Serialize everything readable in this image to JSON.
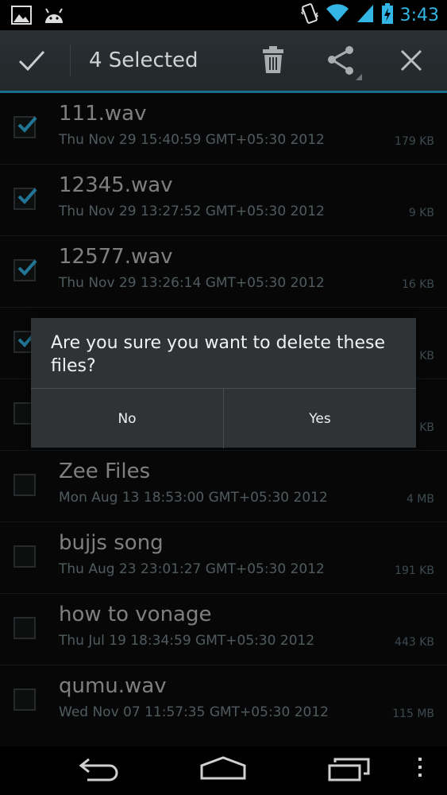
{
  "status_bar": {
    "time": "3:43",
    "icons": [
      "gallery-icon",
      "android-icon",
      "vibrate-icon",
      "wifi-icon",
      "signal-icon",
      "battery-charging-icon"
    ]
  },
  "action_bar": {
    "title": "4 Selected",
    "icons": [
      "checkmark-icon",
      "trash-icon",
      "share-icon",
      "close-icon"
    ],
    "accent_color": "#33b5e5"
  },
  "files": [
    {
      "name": "111.wav",
      "date": "Thu Nov 29 15:40:59 GMT+05:30 2012",
      "size": "179 KB",
      "checked": true
    },
    {
      "name": "12345.wav",
      "date": "Thu Nov 29 13:27:52 GMT+05:30 2012",
      "size": "9 KB",
      "checked": true
    },
    {
      "name": "12577.wav",
      "date": "Thu Nov 29 13:26:14 GMT+05:30 2012",
      "size": "16 KB",
      "checked": true
    },
    {
      "name": "",
      "date": "",
      "size": "KB",
      "checked": true
    },
    {
      "name": "",
      "date": "",
      "size": "KB",
      "checked": false
    },
    {
      "name": "Zee Files",
      "date": "Mon Aug 13 18:53:00 GMT+05:30 2012",
      "size": "4 MB",
      "checked": false
    },
    {
      "name": "bujjs song",
      "date": "Thu Aug 23 23:01:27 GMT+05:30 2012",
      "size": "191 KB",
      "checked": false
    },
    {
      "name": "how to vonage",
      "date": "Thu Jul 19 18:34:59 GMT+05:30 2012",
      "size": "443 KB",
      "checked": false
    },
    {
      "name": "qumu.wav",
      "date": "Wed Nov 07 11:57:35 GMT+05:30 2012",
      "size": "115 MB",
      "checked": false
    }
  ],
  "dialog": {
    "message": "Are you sure you want to delete these files?",
    "no_label": "No",
    "yes_label": "Yes"
  },
  "nav_bar": {
    "icons": [
      "back-icon",
      "home-icon",
      "recent-apps-icon",
      "overflow-menu-icon"
    ]
  }
}
